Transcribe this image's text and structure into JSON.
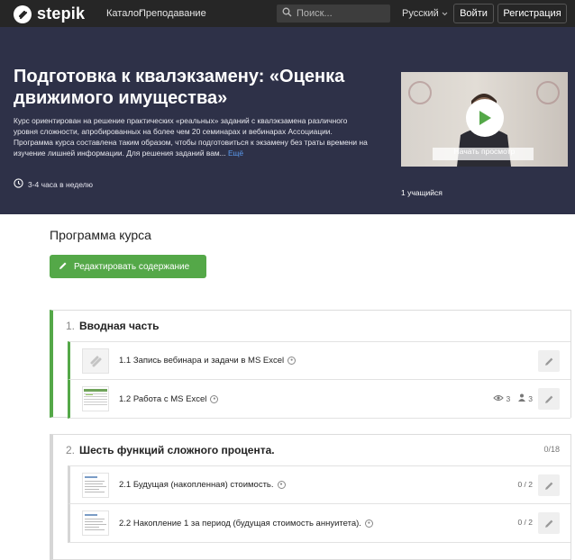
{
  "header": {
    "brand": "stepik",
    "nav": [
      "Каталог",
      "Преподавание"
    ],
    "search_placeholder": "Поиск...",
    "language": "Русский",
    "login_label": "Войти",
    "register_label": "Регистрация"
  },
  "hero": {
    "title": "Подготовка к квалэкзамену: «Оценка движимого имущества»",
    "description": "Курс ориентирован на решение практических «реальных» заданий с квалэкзамена различного уровня сложности, апробированных на более чем 20 семинарах и вебинарах Ассоциации. Программа курса составлена таким образом, чтобы подготовиться к экзамену без траты времени на изучение лишней информации. Для решения заданий вам...",
    "more_label": "Ещё",
    "hours": "3-4 часа в неделю",
    "video_label": "Начать просмотр",
    "learners": "1 учащийся"
  },
  "program": {
    "title": "Программа курса",
    "edit_label": "Редактировать содержание",
    "sections": [
      {
        "number": "1.",
        "title": "Вводная часть",
        "progress": "",
        "lessons": [
          {
            "title": "1.1 Запись вебинара и задачи в MS Excel",
            "views": "",
            "users": "",
            "progress": ""
          },
          {
            "title": "1.2 Работа с MS Excel",
            "views": "3",
            "users": "3",
            "progress": ""
          }
        ]
      },
      {
        "number": "2.",
        "title": "Шесть функций сложного процента.",
        "progress": "0/18",
        "lessons": [
          {
            "title": "2.1 Будущая (накопленная) стоимость.",
            "views": "",
            "users": "",
            "progress": "0 / 2"
          },
          {
            "title": "2.2 Накопление 1 за период (будущая стоимость аннуитета).",
            "views": "",
            "users": "",
            "progress": "0 / 2"
          }
        ]
      }
    ]
  },
  "colors": {
    "topbar": "#262626",
    "hero": "#2e3148",
    "accent_green": "#54a848",
    "play_green": "#54a848",
    "link_blue": "#5b9bf0"
  }
}
